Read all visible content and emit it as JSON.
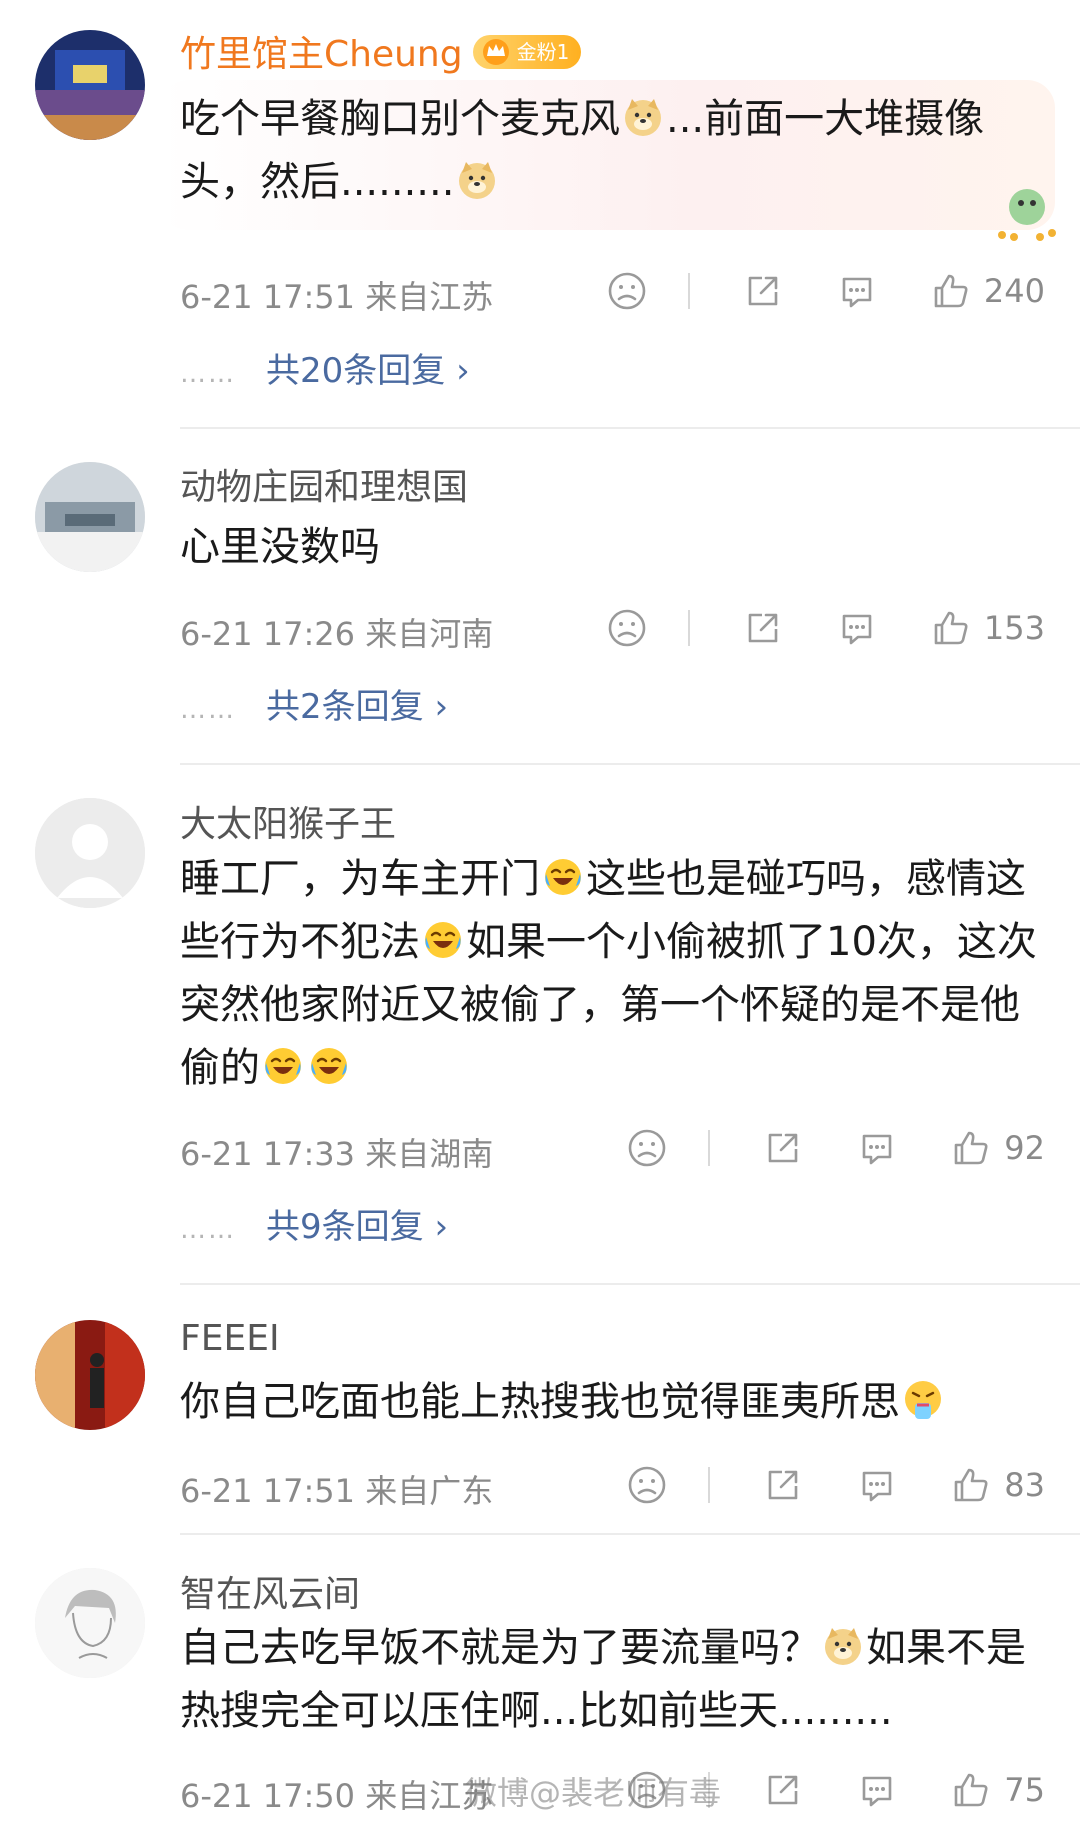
{
  "comments": [
    {
      "user": "竹里馆主Cheung",
      "badge": "金粉1",
      "text_a": "吃个早餐胸口别个麦克风",
      "text_b": "...前面一大堆摄像头，然后.........",
      "time": "6-21 17:51 来自江苏",
      "likes": "240",
      "replies": "共20条回复 ›",
      "replies_dots": "……"
    },
    {
      "user": "动物庄园和理想国",
      "text": "心里没数吗",
      "time": "6-21 17:26 来自河南",
      "likes": "153",
      "replies": "共2条回复 ›",
      "replies_dots": "……"
    },
    {
      "user": "大太阳猴子王",
      "text_a": "睡工厂，为车主开门",
      "text_b": "这些也是碰巧吗，感情这些行为不犯法",
      "text_c": "如果一个小偷被抓了10次，这次突然他家附近又被偷了，第一个怀疑的是不是他偷的",
      "time": "6-21 17:33 来自湖南",
      "likes": "92",
      "replies": "共9条回复 ›",
      "replies_dots": "……"
    },
    {
      "user": "FEEEI",
      "text": "你自己吃面也能上热搜我也觉得匪夷所思",
      "time": "6-21 17:51 来自广东",
      "likes": "83"
    },
    {
      "user": "智在风云间",
      "text_a": "自己去吃早饭不就是为了要流量吗？",
      "text_b": "如果不是 热搜完全可以压住啊...比如前些天.........",
      "time": "6-21 17:50 来自江苏",
      "likes": "75"
    }
  ],
  "watermark": "微博@裴老师有毒",
  "icons": [
    "sad-face-icon",
    "share-icon",
    "comment-icon",
    "like-icon",
    "doge-emoji",
    "laugh-cry-emoji",
    "vomit-emoji",
    "crown-icon"
  ],
  "colors": {
    "vip_name": "#f0781e",
    "reply_link": "#4a6aa0",
    "meta": "#8a8a8a"
  }
}
